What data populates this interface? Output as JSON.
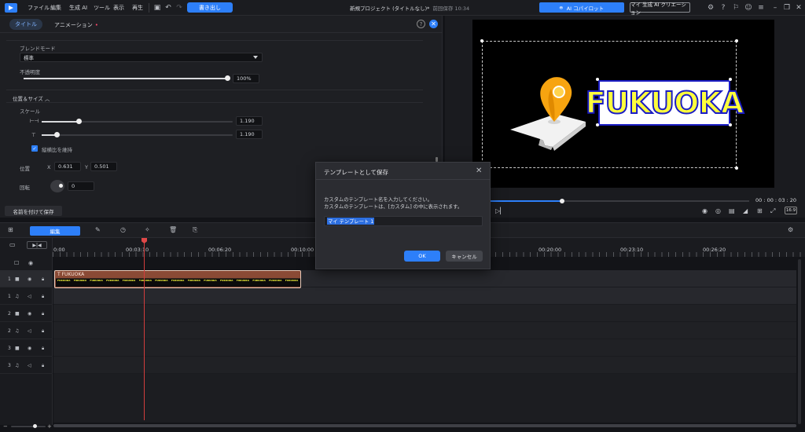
{
  "menubar": {
    "items": [
      "ファイル",
      "編集",
      "生成 AI",
      "ツール",
      "表示",
      "再生"
    ],
    "export_label": "書き出し",
    "project_title": "新規プロジェクト (タイトルなし)*",
    "project_saved": "前回保存 10:34",
    "copilot_label": "AI コパイロット",
    "creation_label": "マイ 生成 AI クリエーション"
  },
  "leftpanel": {
    "tab_title": "タイトル",
    "tab_animation": "アニメーション",
    "blend_label": "ブレンドモード",
    "blend_value": "標準",
    "opacity_label": "不透明度",
    "opacity_value": "100%",
    "opacity_level": 1.0,
    "position_size_label": "位置＆サイズ",
    "scale_label": "スケール",
    "scale_w_value": "1.190",
    "scale_h_value": "1.190",
    "keep_ratio_label": "縦横比を維持",
    "position_label": "位置",
    "pos_x_label": "X",
    "pos_x_value": "0.631",
    "pos_y_label": "Y",
    "pos_y_value": "0.501",
    "rotation_label": "回転",
    "rotation_value": "0",
    "save_as_label": "名前を付けて保存"
  },
  "preview": {
    "title_text": "FUKUOKA",
    "timecode": "00 : 00 : 03 : 20",
    "playback_progress": 0.29,
    "aspect_ratio": "16:9"
  },
  "timeline": {
    "edit_label": "編集",
    "ticks": [
      "0:00",
      "00:03:10",
      "00:06:20",
      "00:10:00",
      "00:20:00",
      "00:23:10",
      "00:26:20"
    ],
    "clip_label": "FUKUOKA",
    "track_numbers": [
      "1",
      "1",
      "2",
      "2",
      "3",
      "3"
    ],
    "thumb_text": "FUKUOKA"
  },
  "dialog": {
    "title": "テンプレートとして保存",
    "message_line1": "カスタムのテンプレート名を入力してください。",
    "message_line2": "カスタムのテンプレートは、[カスタム] の中に表示されます。",
    "input_value": "マイ テンプレート 1",
    "ok_label": "OK",
    "cancel_label": "キャンセル"
  },
  "colors": {
    "accent": "#2d7ff9",
    "playhead": "#d23d3d",
    "clip": "#8a4a35",
    "title_fill": "#ffff3c",
    "title_stroke": "#1a1cc4"
  }
}
